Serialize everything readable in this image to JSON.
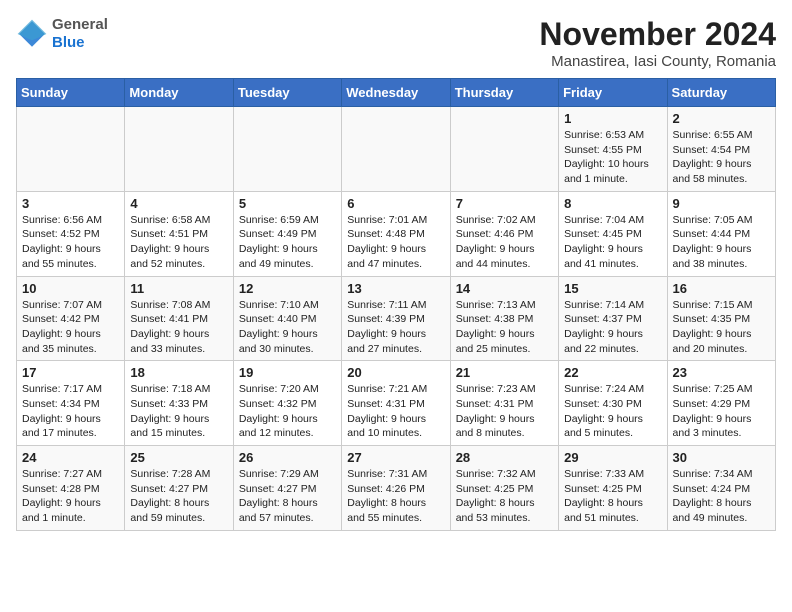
{
  "logo": {
    "general": "General",
    "blue": "Blue"
  },
  "title": "November 2024",
  "location": "Manastirea, Iasi County, Romania",
  "days_of_week": [
    "Sunday",
    "Monday",
    "Tuesday",
    "Wednesday",
    "Thursday",
    "Friday",
    "Saturday"
  ],
  "weeks": [
    [
      {
        "day": "",
        "info": ""
      },
      {
        "day": "",
        "info": ""
      },
      {
        "day": "",
        "info": ""
      },
      {
        "day": "",
        "info": ""
      },
      {
        "day": "",
        "info": ""
      },
      {
        "day": "1",
        "info": "Sunrise: 6:53 AM\nSunset: 4:55 PM\nDaylight: 10 hours and 1 minute."
      },
      {
        "day": "2",
        "info": "Sunrise: 6:55 AM\nSunset: 4:54 PM\nDaylight: 9 hours and 58 minutes."
      }
    ],
    [
      {
        "day": "3",
        "info": "Sunrise: 6:56 AM\nSunset: 4:52 PM\nDaylight: 9 hours and 55 minutes."
      },
      {
        "day": "4",
        "info": "Sunrise: 6:58 AM\nSunset: 4:51 PM\nDaylight: 9 hours and 52 minutes."
      },
      {
        "day": "5",
        "info": "Sunrise: 6:59 AM\nSunset: 4:49 PM\nDaylight: 9 hours and 49 minutes."
      },
      {
        "day": "6",
        "info": "Sunrise: 7:01 AM\nSunset: 4:48 PM\nDaylight: 9 hours and 47 minutes."
      },
      {
        "day": "7",
        "info": "Sunrise: 7:02 AM\nSunset: 4:46 PM\nDaylight: 9 hours and 44 minutes."
      },
      {
        "day": "8",
        "info": "Sunrise: 7:04 AM\nSunset: 4:45 PM\nDaylight: 9 hours and 41 minutes."
      },
      {
        "day": "9",
        "info": "Sunrise: 7:05 AM\nSunset: 4:44 PM\nDaylight: 9 hours and 38 minutes."
      }
    ],
    [
      {
        "day": "10",
        "info": "Sunrise: 7:07 AM\nSunset: 4:42 PM\nDaylight: 9 hours and 35 minutes."
      },
      {
        "day": "11",
        "info": "Sunrise: 7:08 AM\nSunset: 4:41 PM\nDaylight: 9 hours and 33 minutes."
      },
      {
        "day": "12",
        "info": "Sunrise: 7:10 AM\nSunset: 4:40 PM\nDaylight: 9 hours and 30 minutes."
      },
      {
        "day": "13",
        "info": "Sunrise: 7:11 AM\nSunset: 4:39 PM\nDaylight: 9 hours and 27 minutes."
      },
      {
        "day": "14",
        "info": "Sunrise: 7:13 AM\nSunset: 4:38 PM\nDaylight: 9 hours and 25 minutes."
      },
      {
        "day": "15",
        "info": "Sunrise: 7:14 AM\nSunset: 4:37 PM\nDaylight: 9 hours and 22 minutes."
      },
      {
        "day": "16",
        "info": "Sunrise: 7:15 AM\nSunset: 4:35 PM\nDaylight: 9 hours and 20 minutes."
      }
    ],
    [
      {
        "day": "17",
        "info": "Sunrise: 7:17 AM\nSunset: 4:34 PM\nDaylight: 9 hours and 17 minutes."
      },
      {
        "day": "18",
        "info": "Sunrise: 7:18 AM\nSunset: 4:33 PM\nDaylight: 9 hours and 15 minutes."
      },
      {
        "day": "19",
        "info": "Sunrise: 7:20 AM\nSunset: 4:32 PM\nDaylight: 9 hours and 12 minutes."
      },
      {
        "day": "20",
        "info": "Sunrise: 7:21 AM\nSunset: 4:31 PM\nDaylight: 9 hours and 10 minutes."
      },
      {
        "day": "21",
        "info": "Sunrise: 7:23 AM\nSunset: 4:31 PM\nDaylight: 9 hours and 8 minutes."
      },
      {
        "day": "22",
        "info": "Sunrise: 7:24 AM\nSunset: 4:30 PM\nDaylight: 9 hours and 5 minutes."
      },
      {
        "day": "23",
        "info": "Sunrise: 7:25 AM\nSunset: 4:29 PM\nDaylight: 9 hours and 3 minutes."
      }
    ],
    [
      {
        "day": "24",
        "info": "Sunrise: 7:27 AM\nSunset: 4:28 PM\nDaylight: 9 hours and 1 minute."
      },
      {
        "day": "25",
        "info": "Sunrise: 7:28 AM\nSunset: 4:27 PM\nDaylight: 8 hours and 59 minutes."
      },
      {
        "day": "26",
        "info": "Sunrise: 7:29 AM\nSunset: 4:27 PM\nDaylight: 8 hours and 57 minutes."
      },
      {
        "day": "27",
        "info": "Sunrise: 7:31 AM\nSunset: 4:26 PM\nDaylight: 8 hours and 55 minutes."
      },
      {
        "day": "28",
        "info": "Sunrise: 7:32 AM\nSunset: 4:25 PM\nDaylight: 8 hours and 53 minutes."
      },
      {
        "day": "29",
        "info": "Sunrise: 7:33 AM\nSunset: 4:25 PM\nDaylight: 8 hours and 51 minutes."
      },
      {
        "day": "30",
        "info": "Sunrise: 7:34 AM\nSunset: 4:24 PM\nDaylight: 8 hours and 49 minutes."
      }
    ]
  ]
}
